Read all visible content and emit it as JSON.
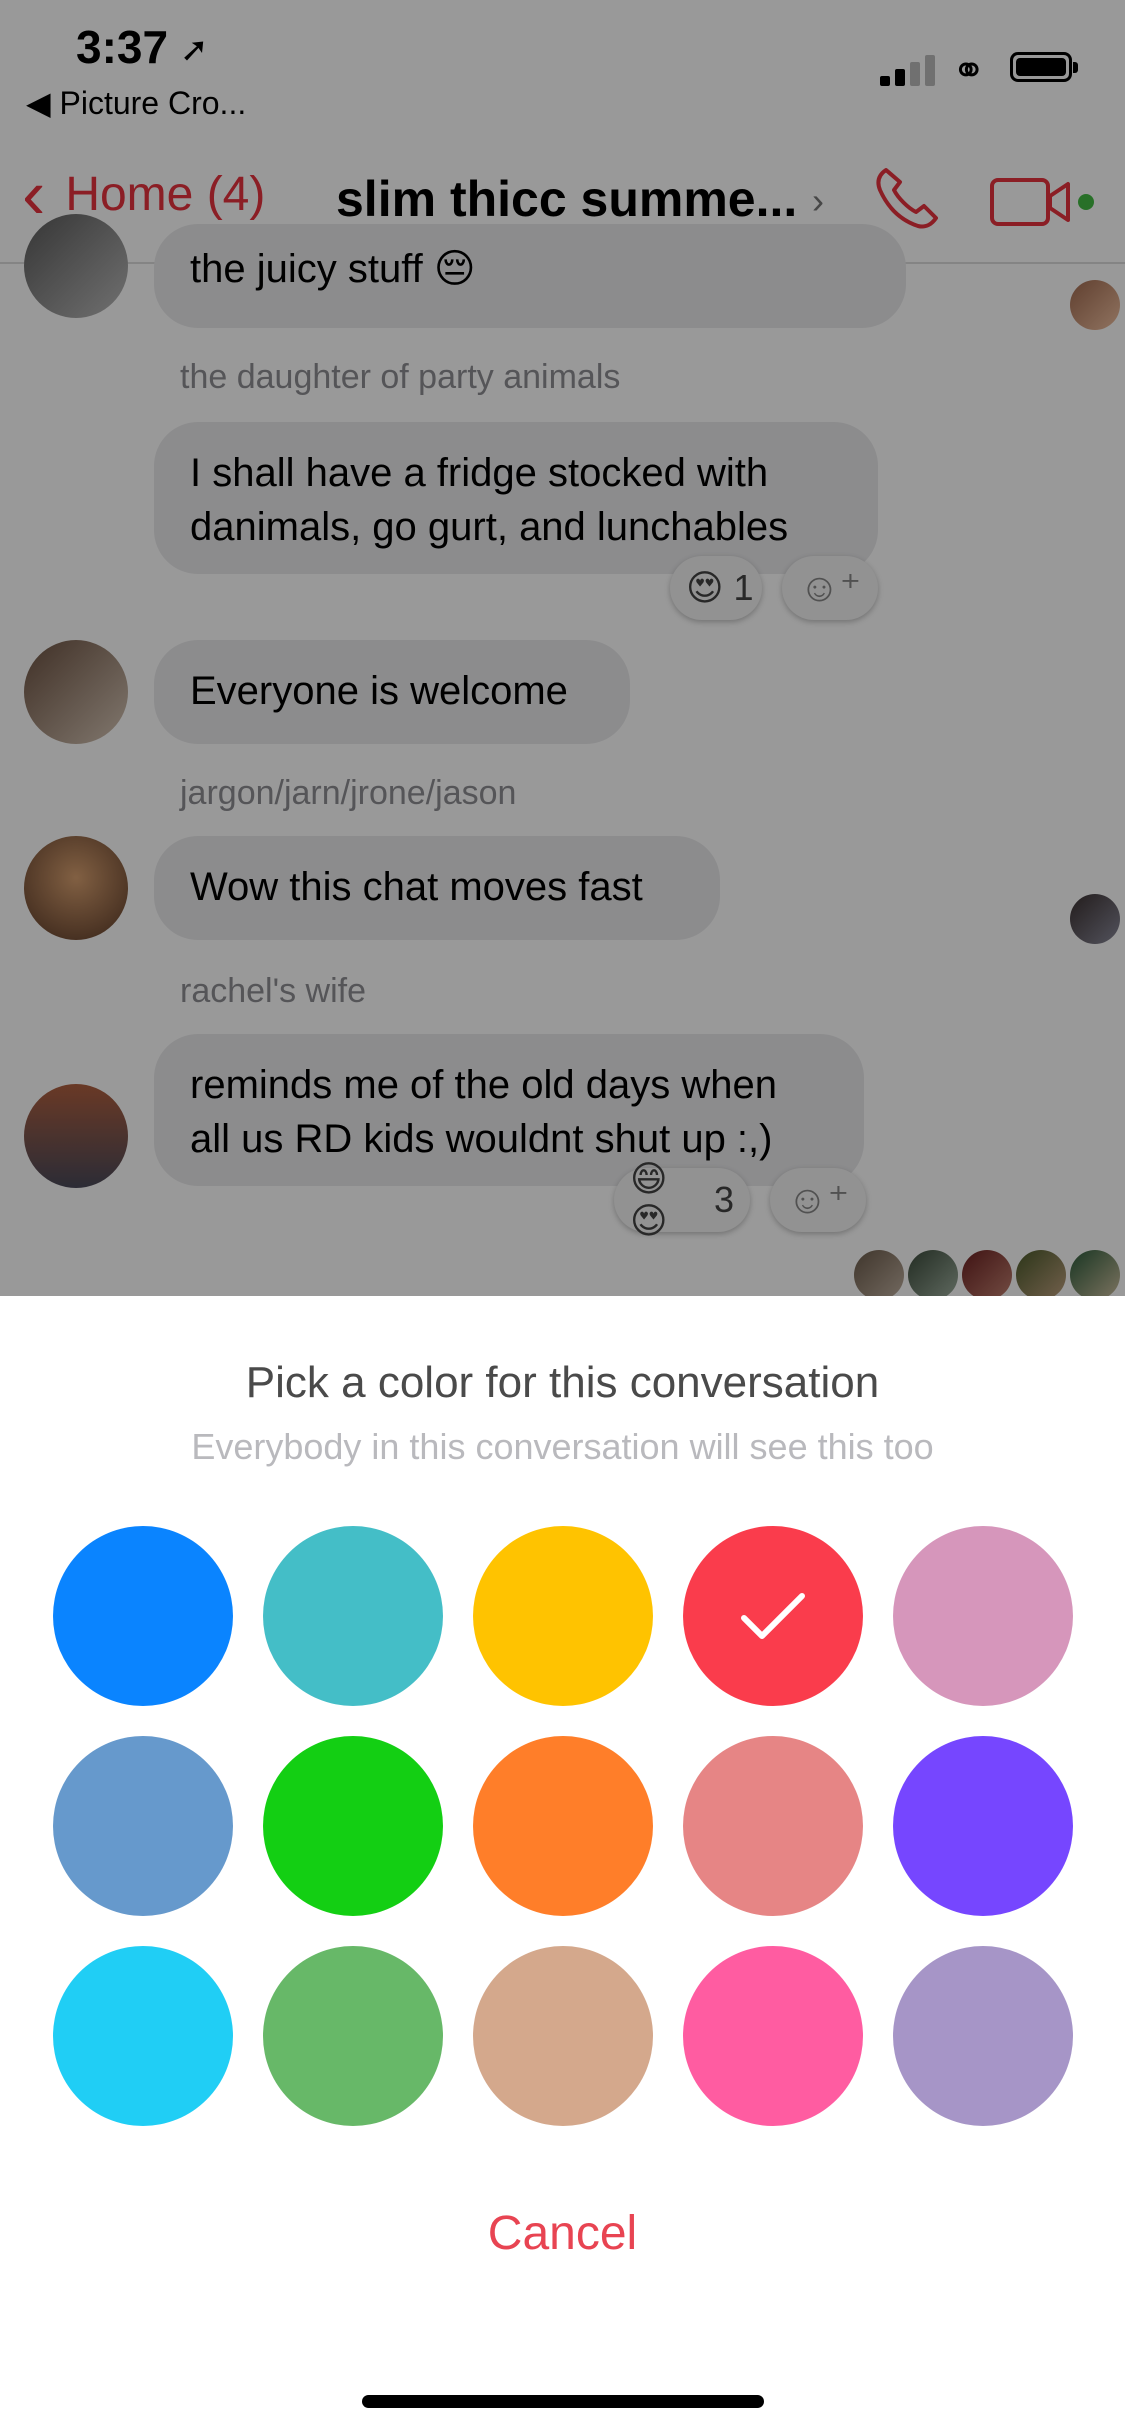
{
  "status_bar": {
    "time": "3:37",
    "back_app": "Picture Cro..."
  },
  "nav": {
    "back_label": "Home (4)",
    "title": "slim thicc summe..."
  },
  "messages": {
    "m1_text": "the juicy stuff",
    "m1_emoji": "😔",
    "sender_2": "the daughter of party animals",
    "m2_text": "I shall have a fridge stocked with danimals, go gurt, and lunchables",
    "m2_reaction_emoji": "😍",
    "m2_reaction_count": "1",
    "m3_text": "Everyone is welcome",
    "sender_4": "jargon/jarn/jrone/jason",
    "m4_text": "Wow this chat moves fast",
    "sender_5": "rachel's wife",
    "m5_text": "reminds me of the old days when all us RD kids wouldnt shut up :,)",
    "m5_reaction_emoji": "😄😍",
    "m5_reaction_count": "3"
  },
  "sheet": {
    "title": "Pick a color for this conversation",
    "subtitle": "Everybody in this conversation will see this too",
    "colors": [
      "#0a84ff",
      "#44bec7",
      "#ffc300",
      "#fa3c4c",
      "#d696bb",
      "#6699cc",
      "#13cf13",
      "#ff7e29",
      "#e68585",
      "#7646ff",
      "#20cef5",
      "#67b868",
      "#d4a88c",
      "#ff5ca1",
      "#a695c7"
    ],
    "selected_index": 3,
    "cancel_label": "Cancel"
  },
  "accent_color": "#e8323e"
}
